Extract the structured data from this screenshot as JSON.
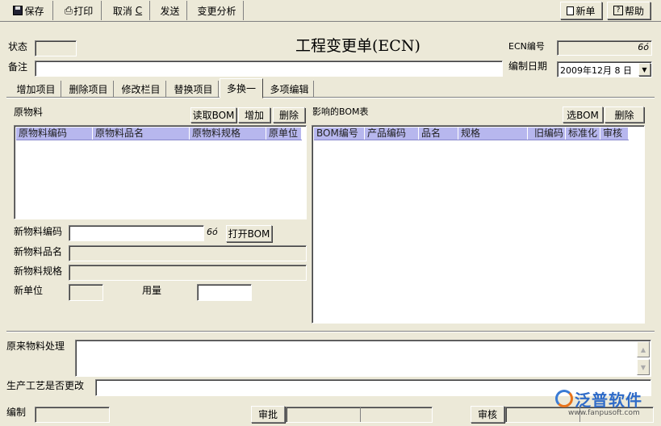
{
  "toolbar": {
    "save": "保存",
    "print": "打印",
    "cancel": "取消",
    "cancel_key": "C",
    "send": "发送",
    "change_analysis": "变更分析",
    "new": "新单",
    "help": "帮助"
  },
  "form": {
    "title": "工程变更单(ECN)",
    "status_label": "状态",
    "remark_label": "备注",
    "ecn_no_label": "ECN编号",
    "date_label": "编制日期",
    "date_value": "2009年12月 8 日"
  },
  "tabs": [
    "增加项目",
    "删除项目",
    "修改栏目",
    "替换项目",
    "多换一",
    "多项编辑"
  ],
  "left": {
    "title": "原物料",
    "read_bom": "读取BOM",
    "add": "增加",
    "delete": "删除",
    "columns": [
      "原物料编码",
      "原物料品名",
      "原物料规格",
      "原单位"
    ],
    "new_code_label": "新物料编码",
    "open_bom": "打开BOM",
    "new_name_label": "新物料品名",
    "new_spec_label": "新物料规格",
    "new_unit_label": "新单位",
    "qty_label": "用量"
  },
  "right": {
    "title": "影响的BOM表",
    "select_bom": "选BOM",
    "delete": "删除",
    "columns": [
      "BOM编号",
      "产品编码",
      "品名",
      "规格",
      "旧编码",
      "标准化",
      "审核"
    ]
  },
  "bottom": {
    "old_handling_label": "原来物料处理",
    "process_change_label": "生产工艺是否更改",
    "prepare_label": "编制",
    "approve_label": "审批",
    "review_label": "审核"
  },
  "watermark": {
    "brand": "泛普软件",
    "url": "www.fanpusoft.com"
  }
}
